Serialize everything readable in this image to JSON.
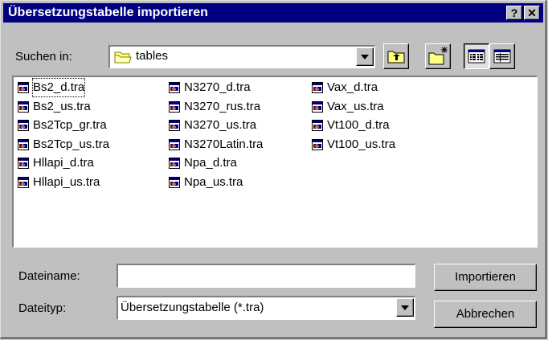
{
  "window": {
    "title": "Übersetzungstabelle importieren",
    "help_label": "?",
    "close_label": "✕"
  },
  "lookin": {
    "label": "Suchen in:",
    "value": "tables"
  },
  "toolbar": {
    "icons": [
      "up-one-level-icon",
      "new-folder-icon",
      "list-view-icon",
      "details-view-icon"
    ]
  },
  "files": {
    "col1": [
      "Bs2_d.tra",
      "Bs2_us.tra",
      "Bs2Tcp_gr.tra",
      "Bs2Tcp_us.tra",
      "Hllapi_d.tra",
      "Hllapi_us.tra"
    ],
    "col2": [
      "N3270_d.tra",
      "N3270_rus.tra",
      "N3270_us.tra",
      "N3270Latin.tra",
      "Npa_d.tra",
      "Npa_us.tra"
    ],
    "col3": [
      "Vax_d.tra",
      "Vax_us.tra",
      "Vt100_d.tra",
      "Vt100_us.tra"
    ],
    "selected": "Bs2_d.tra"
  },
  "filename": {
    "label": "Dateiname:",
    "value": ""
  },
  "filetype": {
    "label": "Dateityp:",
    "value": "Übersetzungstabelle (*.tra)"
  },
  "buttons": {
    "import": "Importieren",
    "cancel": "Abbrechen"
  }
}
